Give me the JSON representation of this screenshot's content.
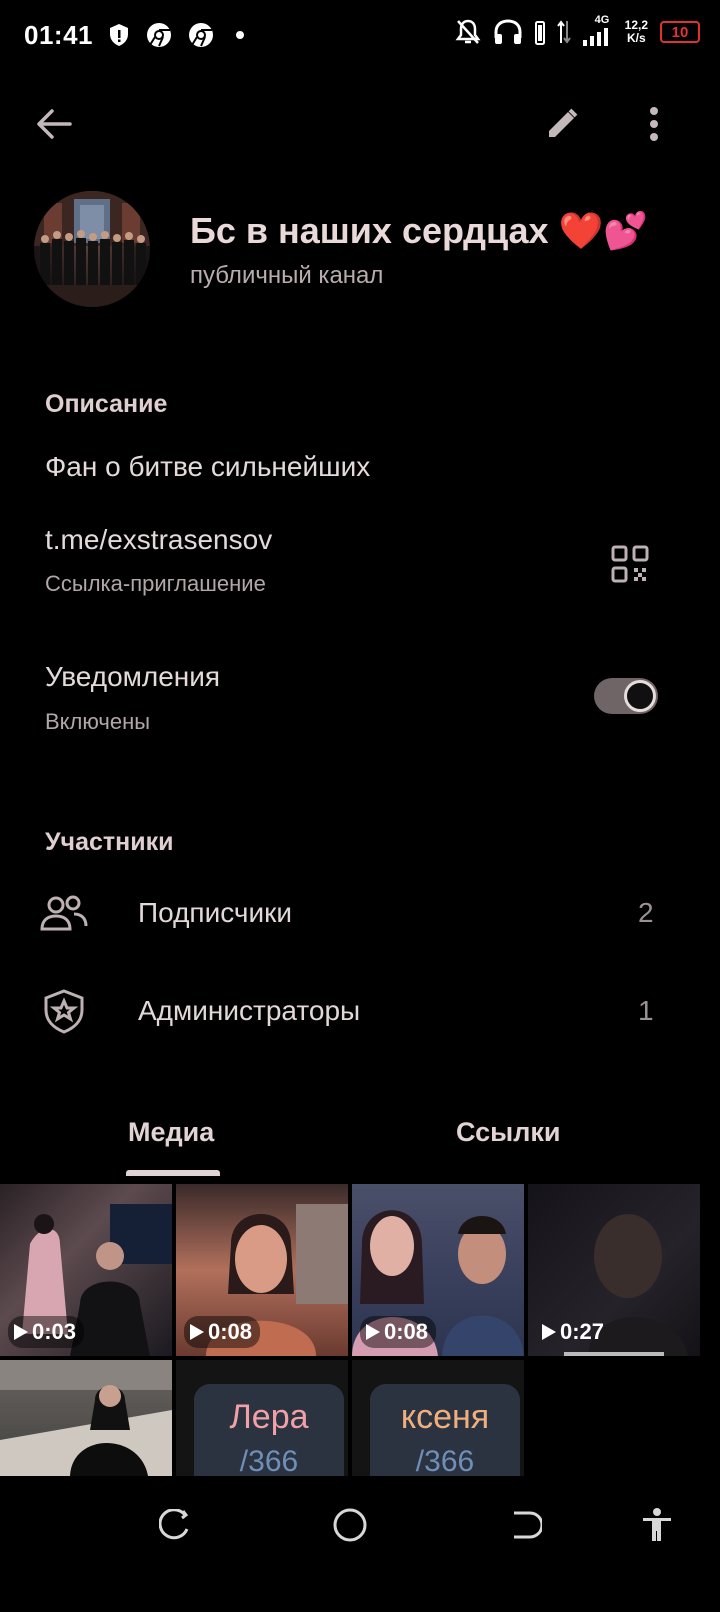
{
  "status_bar": {
    "time": "01:41",
    "network": "4G",
    "speed_value": "12,2",
    "speed_unit": "K/s",
    "battery": "10"
  },
  "channel": {
    "name": "Бс в наших сердцах ❤️💕",
    "type": "публичный канал"
  },
  "description": {
    "title": "Описание",
    "text": "Фан о битве сильнейших"
  },
  "invite": {
    "link": "t.me/exstrasensov",
    "label": "Ссылка-приглашение"
  },
  "notifications": {
    "title": "Уведомления",
    "state": "Включены",
    "enabled": true
  },
  "participants": {
    "title": "Участники",
    "rows": [
      {
        "label": "Подписчики",
        "count": "2",
        "icon": "people-icon"
      },
      {
        "label": "Администраторы",
        "count": "1",
        "icon": "shield-star-icon"
      }
    ]
  },
  "tabs": [
    {
      "label": "Медиа",
      "active": true
    },
    {
      "label": "Ссылки",
      "active": false
    }
  ],
  "media": [
    {
      "duration": "0:03"
    },
    {
      "duration": "0:08"
    },
    {
      "duration": "0:08"
    },
    {
      "duration": "0:27"
    },
    {},
    {
      "text": "Лера",
      "sub": "/366"
    },
    {
      "text": "ксеня",
      "sub": "/366"
    }
  ],
  "colors": {
    "background": "#000000",
    "accent": "#e0d3d4",
    "toggle_track": "#6f6466",
    "battery_low": "#dd3333"
  }
}
